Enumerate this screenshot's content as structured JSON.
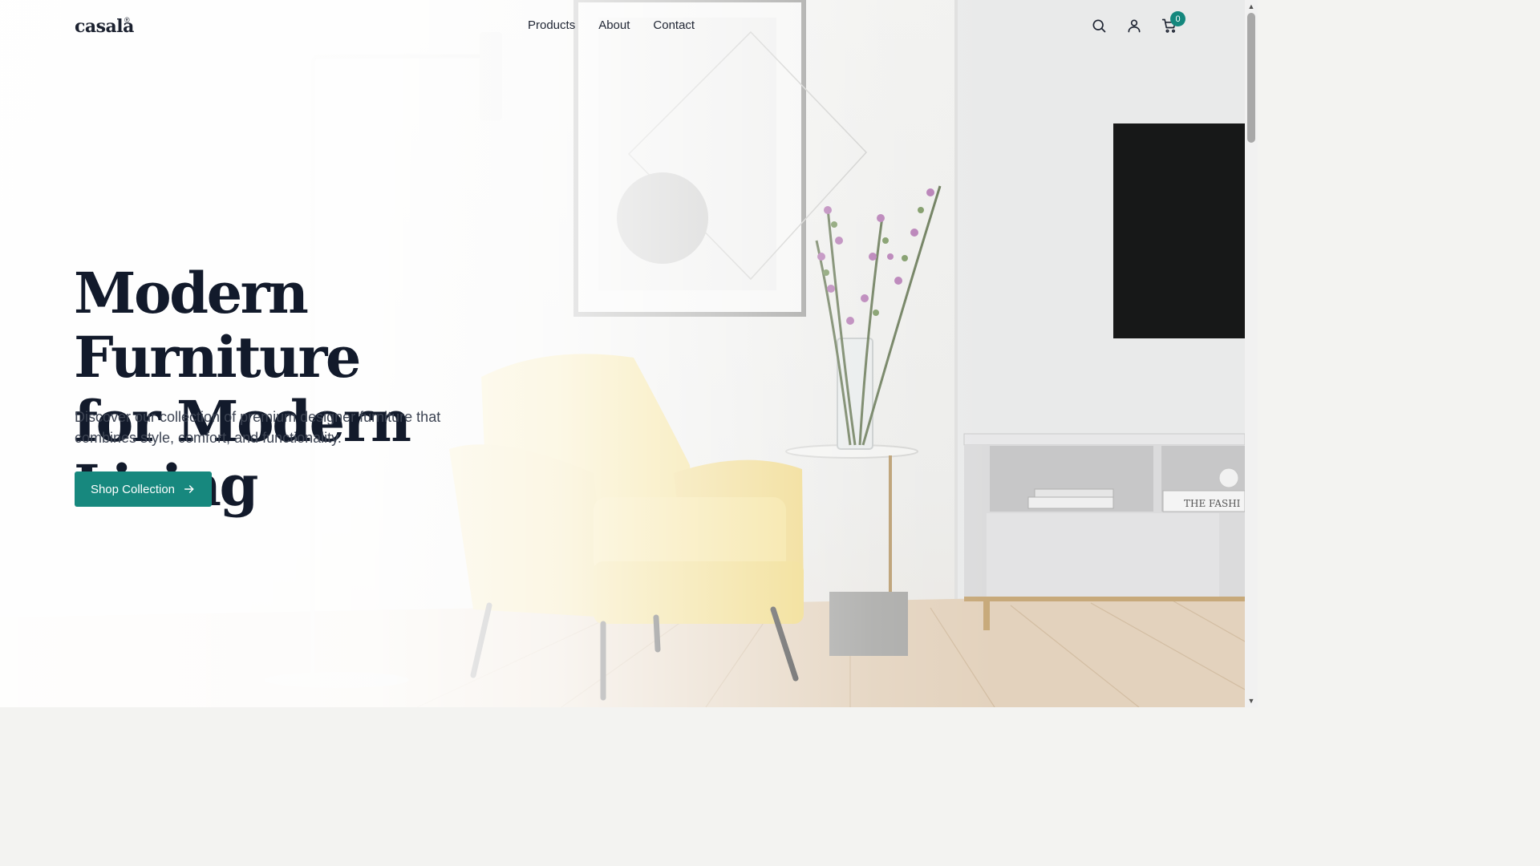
{
  "brand": {
    "name": "casala",
    "mark": "®"
  },
  "nav": {
    "items": [
      {
        "label": "Products"
      },
      {
        "label": "About"
      },
      {
        "label": "Contact"
      }
    ]
  },
  "header_icons": {
    "search": "search-icon",
    "account": "user-icon",
    "cart": "cart-icon",
    "cart_count": "0"
  },
  "hero": {
    "title_line1": "Modern Furniture",
    "title_line2": "for Modern Living",
    "subtitle": "Discover our collection of premium designer furniture that combines style, comfort, and functionality.",
    "cta_label": "Shop Collection",
    "cta_icon": "arrow-right-icon"
  },
  "colors": {
    "accent": "#17887e",
    "heading": "#121a2b",
    "text": "#3d4453"
  },
  "background": {
    "shelf_book_text": "THE FASHI"
  }
}
